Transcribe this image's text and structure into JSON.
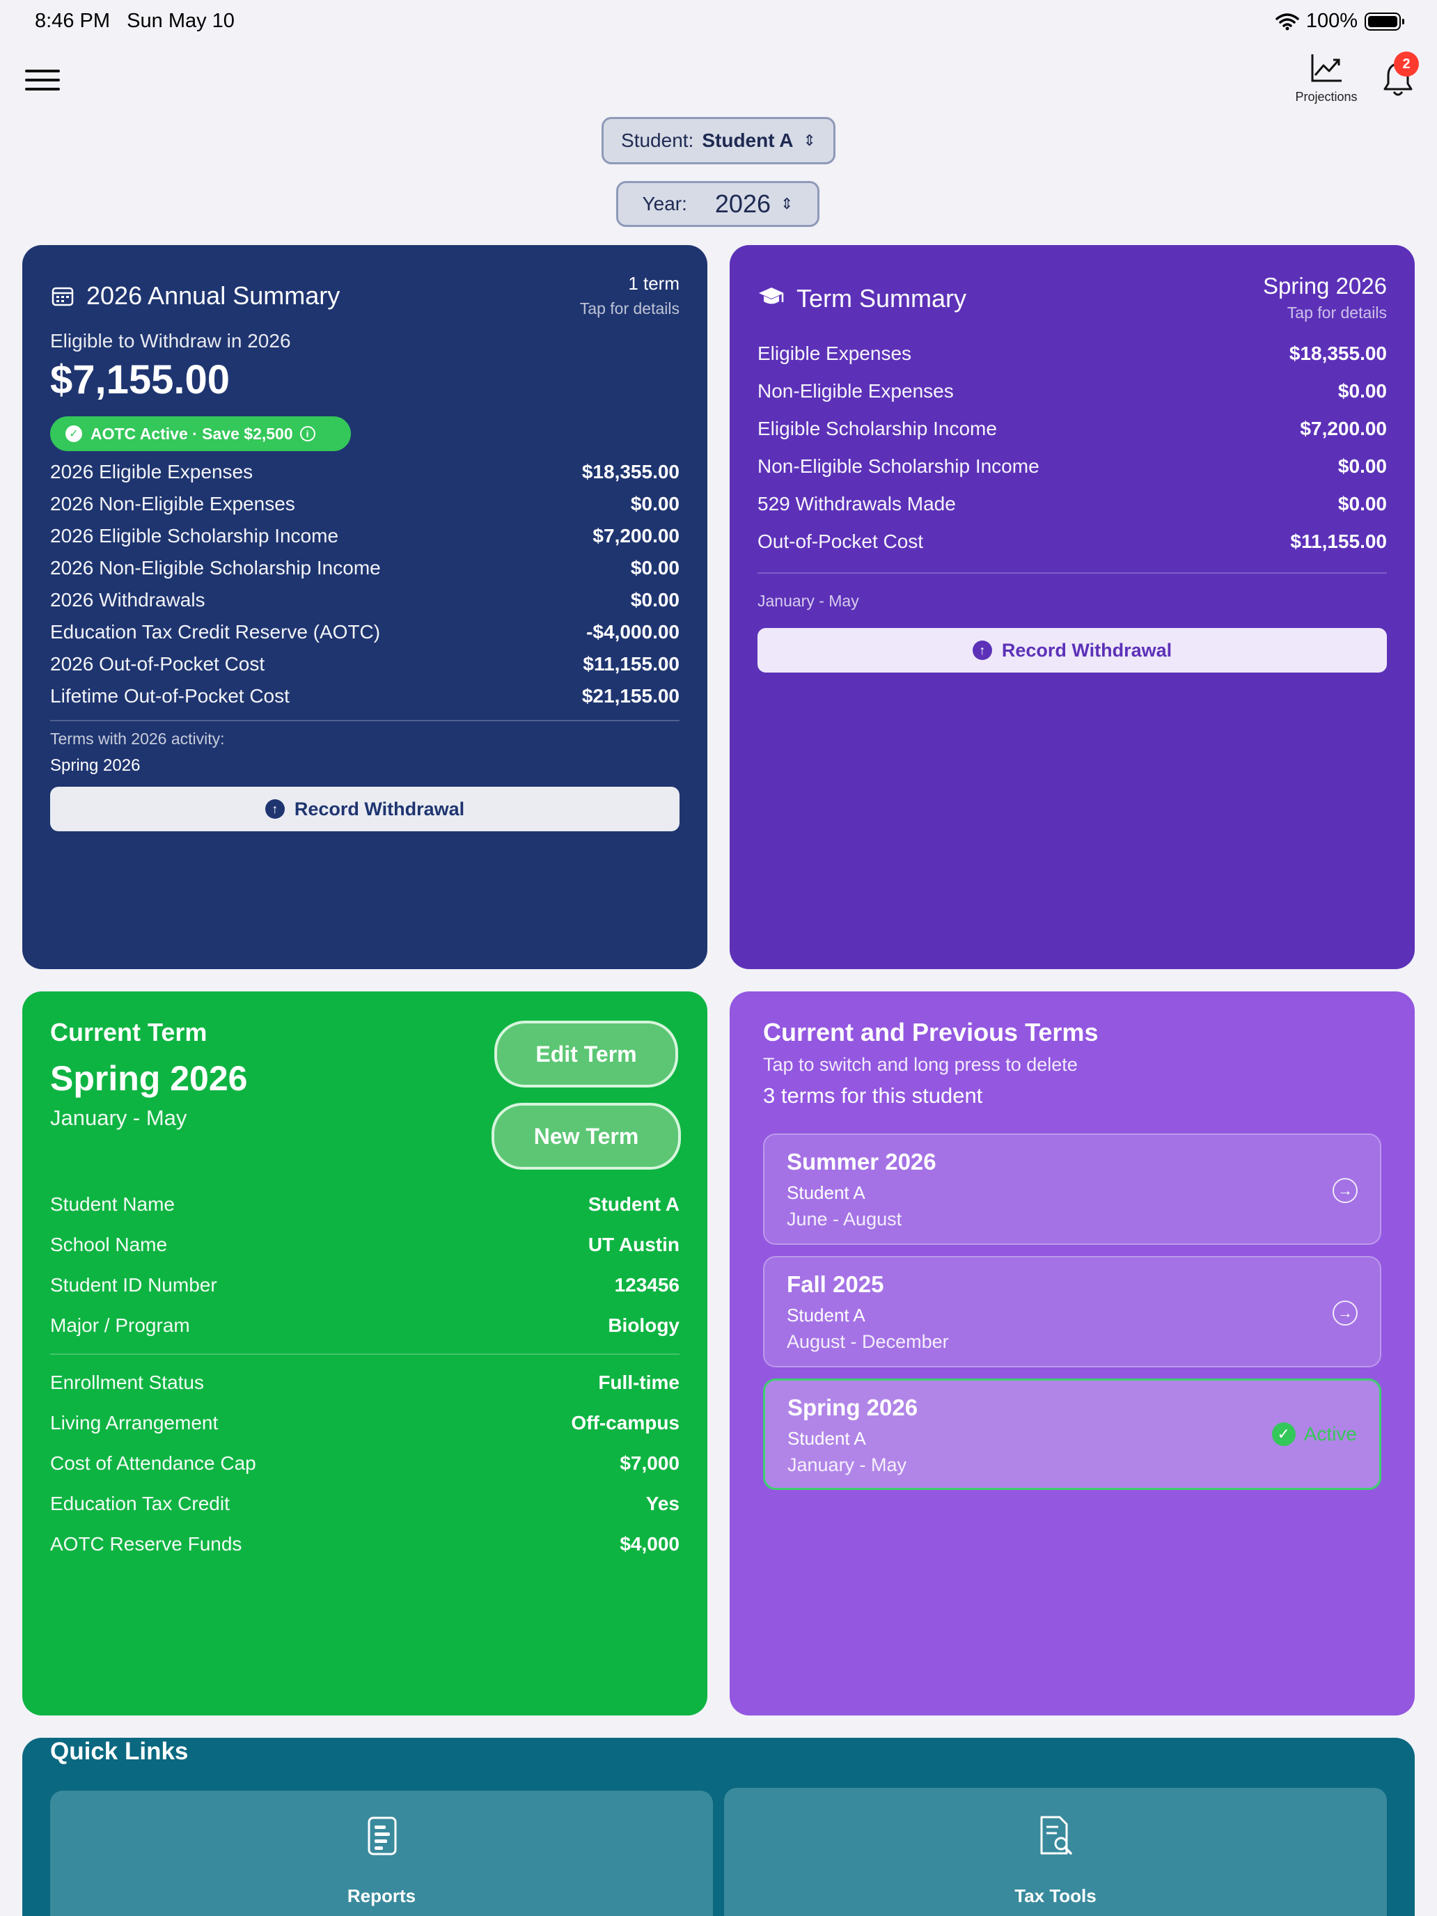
{
  "status_bar": {
    "time": "8:46 PM",
    "date": "Sun May 10",
    "battery": "100%"
  },
  "nav": {
    "projections_label": "Projections",
    "notification_count": "2"
  },
  "pickers": {
    "student_label": "Student:",
    "student_value": "Student A",
    "year_label": "Year:",
    "year_value": "2026"
  },
  "annual": {
    "title": "2026 Annual Summary",
    "term_count": "1 term",
    "tap_hint": "Tap for details",
    "eligible_label": "Eligible to Withdraw in 2026",
    "eligible_amount": "$7,155.00",
    "badge": "AOTC Active · Save $2,500",
    "rows": [
      {
        "label": "2026 Eligible Expenses",
        "value": "$18,355.00"
      },
      {
        "label": "2026 Non-Eligible Expenses",
        "value": "$0.00"
      },
      {
        "label": "2026 Eligible Scholarship Income",
        "value": "$7,200.00"
      },
      {
        "label": "2026 Non-Eligible Scholarship Income",
        "value": "$0.00"
      },
      {
        "label": "2026 Withdrawals",
        "value": "$0.00"
      },
      {
        "label": "Education Tax Credit Reserve (AOTC)",
        "value": "-$4,000.00"
      },
      {
        "label": "2026 Out-of-Pocket Cost",
        "value": "$11,155.00"
      },
      {
        "label": "Lifetime Out-of-Pocket Cost",
        "value": "$21,155.00"
      }
    ],
    "terms_activity_label": "Terms with 2026 activity:",
    "terms_activity_value": "Spring 2026",
    "record_button": "Record Withdrawal"
  },
  "term_summary": {
    "title": "Term Summary",
    "term_name": "Spring 2026",
    "tap_hint": "Tap for details",
    "rows": [
      {
        "label": "Eligible Expenses",
        "value": "$18,355.00"
      },
      {
        "label": "Non-Eligible Expenses",
        "value": "$0.00"
      },
      {
        "label": "Eligible Scholarship Income",
        "value": "$7,200.00"
      },
      {
        "label": "Non-Eligible Scholarship Income",
        "value": "$0.00"
      },
      {
        "label": "529 Withdrawals Made",
        "value": "$0.00"
      },
      {
        "label": "Out-of-Pocket Cost",
        "value": "$11,155.00"
      }
    ],
    "date_range": "January - May",
    "record_button": "Record Withdrawal"
  },
  "current_term": {
    "heading": "Current Term",
    "name": "Spring 2026",
    "dates": "January - May",
    "edit_button": "Edit Term",
    "new_button": "New Term",
    "rows_a": [
      {
        "label": "Student Name",
        "value": "Student A"
      },
      {
        "label": "School Name",
        "value": "UT Austin"
      },
      {
        "label": "Student ID Number",
        "value": "123456"
      },
      {
        "label": "Major / Program",
        "value": "Biology"
      }
    ],
    "rows_b": [
      {
        "label": "Enrollment Status",
        "value": "Full-time"
      },
      {
        "label": "Living Arrangement",
        "value": "Off-campus"
      },
      {
        "label": "Cost of Attendance Cap",
        "value": "$7,000"
      },
      {
        "label": "Education Tax Credit",
        "value": "Yes"
      },
      {
        "label": "AOTC Reserve Funds",
        "value": "$4,000"
      }
    ]
  },
  "terms_list": {
    "title": "Current and Previous Terms",
    "hint": "Tap to switch and long press to delete",
    "count": "3 terms for this student",
    "items": [
      {
        "name": "Summer 2026",
        "student": "Student A",
        "dates": "June - August"
      },
      {
        "name": "Fall 2025",
        "student": "Student A",
        "dates": "August - December"
      },
      {
        "name": "Spring 2026",
        "student": "Student A",
        "dates": "January - May",
        "status": "Active"
      }
    ]
  },
  "quick_links": {
    "title": "Quick Links",
    "reports_label": "Reports",
    "tax_tools_label": "Tax Tools"
  },
  "colors": {
    "annual_bg": "#1f3570",
    "term_bg": "#5c31b8",
    "current_bg": "#0eb442",
    "prev_bg": "#9357e0",
    "quick_bg": "#0a6880",
    "active_green": "#34c759"
  }
}
